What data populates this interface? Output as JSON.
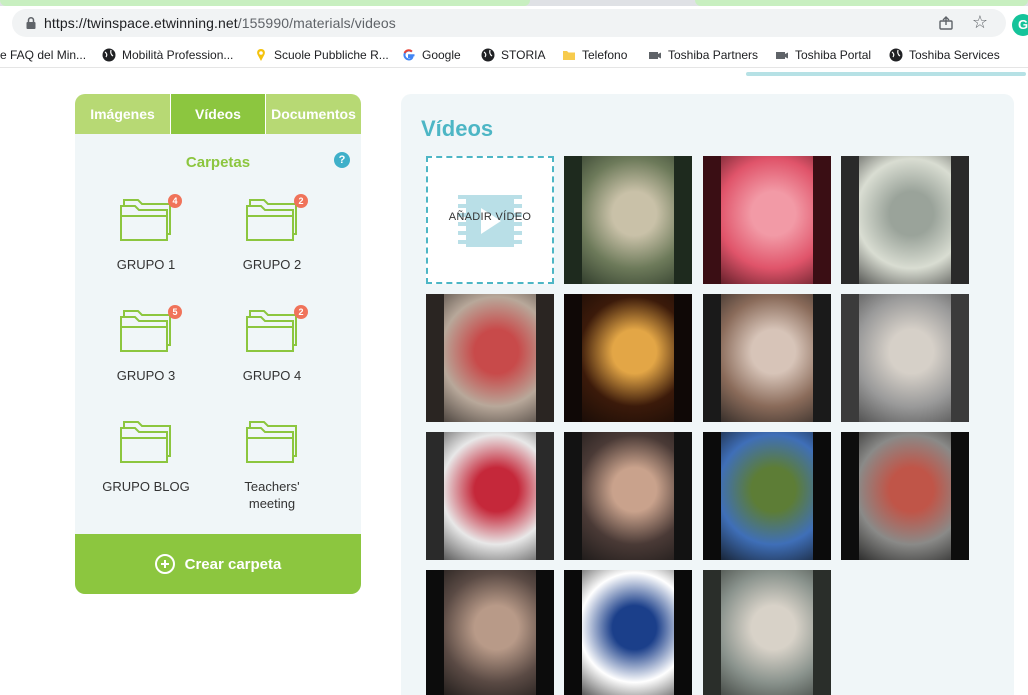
{
  "browser": {
    "url_host": "https://twinspace.etwinning.net",
    "url_path": "/155990/materials/videos",
    "grammarly_label": "G"
  },
  "bookmarks": [
    {
      "label": "e FAQ del Min...",
      "icon": "page-icon"
    },
    {
      "label": "Mobilità Profession...",
      "icon": "globe-icon"
    },
    {
      "label": "Scuole Pubbliche R...",
      "icon": "pin-icon"
    },
    {
      "label": "Google",
      "icon": "google-icon"
    },
    {
      "label": "STORIA",
      "icon": "globe-icon"
    },
    {
      "label": "Telefono",
      "icon": "folder-icon"
    },
    {
      "label": "Toshiba Partners",
      "icon": "toshiba-icon"
    },
    {
      "label": "Toshiba Portal",
      "icon": "toshiba-icon"
    },
    {
      "label": "Toshiba Services",
      "icon": "globe-icon"
    }
  ],
  "sidebar": {
    "tabs": [
      {
        "label": "Imágenes",
        "active": false
      },
      {
        "label": "Vídeos",
        "active": true
      },
      {
        "label": "Documentos",
        "active": false
      }
    ],
    "heading": "Carpetas",
    "help_label": "?",
    "folders": [
      {
        "name": "GRUPO 1",
        "badge": "4"
      },
      {
        "name": "GRUPO 2",
        "badge": "2"
      },
      {
        "name": "GRUPO 3",
        "badge": "5"
      },
      {
        "name": "GRUPO 4",
        "badge": "2"
      },
      {
        "name": "GRUPO BLOG",
        "badge": ""
      },
      {
        "name": "Teachers' meeting",
        "badge": ""
      }
    ],
    "create_label": "Crear carpeta"
  },
  "main": {
    "title": "Vídeos",
    "add_label": "AÑADIR VÍDEO",
    "thumbnails": [
      {
        "id": "aerial-campus",
        "colors": [
          "#1e2a1e",
          "#6d7a5a",
          "#c9c1a8"
        ]
      },
      {
        "id": "phone-call-screen",
        "colors": [
          "#3a0e14",
          "#e0546a",
          "#f29aa6"
        ]
      },
      {
        "id": "whiteboard-notes",
        "colors": [
          "#2a2a2a",
          "#d9ddd2",
          "#9aa39a"
        ]
      },
      {
        "id": "hallway-photo",
        "colors": [
          "#2a2522",
          "#b8a89a",
          "#c84a4a"
        ]
      },
      {
        "id": "golden-figure",
        "colors": [
          "#0f0806",
          "#3b1a0a",
          "#e3a646"
        ]
      },
      {
        "id": "selfie-girls",
        "colors": [
          "#1a1a1a",
          "#8a6b5a",
          "#d7c4b8"
        ]
      },
      {
        "id": "ceiling-selfie",
        "colors": [
          "#3b3b3b",
          "#9a9a9a",
          "#d6d0c8"
        ]
      },
      {
        "id": "covid-map",
        "colors": [
          "#2a2a2a",
          "#e8e8e8",
          "#c5283a"
        ]
      },
      {
        "id": "news-speaker",
        "colors": [
          "#121212",
          "#4a3a36",
          "#c9a28c"
        ]
      },
      {
        "id": "park-students",
        "colors": [
          "#0b0b0b",
          "#3f6fb8",
          "#5d7d36"
        ]
      },
      {
        "id": "street-cyclist",
        "colors": [
          "#0d0d0d",
          "#8a8a88",
          "#c05548"
        ]
      },
      {
        "id": "masked-selfie",
        "colors": [
          "#0c0c0c",
          "#5a4a44",
          "#b89a88"
        ]
      },
      {
        "id": "mask-sign",
        "colors": [
          "#0a0a0a",
          "#ffffff",
          "#1b3f8a"
        ]
      },
      {
        "id": "money-hand",
        "colors": [
          "#2a2e2a",
          "#8a938d",
          "#d8d2c8"
        ]
      }
    ]
  }
}
